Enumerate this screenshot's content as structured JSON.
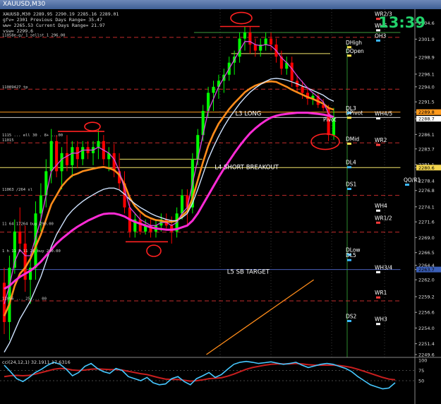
{
  "window": {
    "title": "XAUUSD,M30"
  },
  "header_info": {
    "ohlc": "XAUUSD,M30  2289.95 2290.19 2285.16 2289.01",
    "line2": "gfv= 2301      Previous Days Range= 35.47",
    "line3": "ww= 2265.53    Current Days Range= 21.97",
    "line4": "vsw= 2299.6"
  },
  "clock": "13:39",
  "colors": {
    "background": "#000000",
    "candle_up": "#00ff00",
    "candle_down": "#ff0000",
    "ma_orange": "#ff8c1a",
    "ma_lightblue": "#cfe3ff",
    "ma_magenta": "#ff2bd6",
    "ma_thin_magenta": "#d84be0",
    "level_red": "#c22b2b",
    "level_green": "#3d9b3d",
    "osc_blue": "#46c8ff",
    "osc_red": "#c81e1e",
    "circle": "#ff2020"
  },
  "chart_data": {
    "type": "candlestick",
    "symbol": "XAUUSD",
    "timeframe": "M30",
    "ylim": [
      2249.6,
      2306.4
    ],
    "y_ticks": [
      "2304.6",
      "2301.9",
      "2298.9",
      "2296.1",
      "2294.0",
      "2291.5",
      "2289.8",
      "2288.7",
      "2286.1",
      "2283.7",
      "2281.1",
      "2280.6",
      "2278.4",
      "2276.8",
      "2274.1",
      "2271.6",
      "2269.0",
      "2266.5",
      "2264.4",
      "2263.7",
      "2262.0",
      "2259.2",
      "2256.6",
      "2254.0",
      "2251.4",
      "2249.6"
    ],
    "y_ticks_highlight": [
      "2289.8",
      "2288.7",
      "2280.6",
      "2263.7"
    ],
    "last_price": "2288.7",
    "candles": [
      [
        2261.5,
        2264.0,
        2253.0,
        2255.0
      ],
      [
        2255.0,
        2266.0,
        2252.0,
        2264.0
      ],
      [
        2264.0,
        2272.0,
        2263.0,
        2270.0
      ],
      [
        2270.0,
        2274.0,
        2267.0,
        2268.0
      ],
      [
        2268.0,
        2271.0,
        2260.0,
        2262.0
      ],
      [
        2262.0,
        2266.0,
        2258.0,
        2264.0
      ],
      [
        2264.0,
        2275.0,
        2262.0,
        2273.0
      ],
      [
        2273.0,
        2278.0,
        2270.0,
        2276.0
      ],
      [
        2276.0,
        2282.0,
        2274.0,
        2280.0
      ],
      [
        2280.0,
        2287.0,
        2278.0,
        2285.0
      ],
      [
        2285.0,
        2286.0,
        2279.0,
        2280.0
      ],
      [
        2280.0,
        2284.0,
        2277.0,
        2283.0
      ],
      [
        2283.0,
        2286.0,
        2280.0,
        2281.0
      ],
      [
        2281.0,
        2285.0,
        2279.0,
        2284.0
      ],
      [
        2284.0,
        2285.0,
        2280.5,
        2282.0
      ],
      [
        2282.0,
        2285.0,
        2281.0,
        2284.0
      ],
      [
        2284.0,
        2285.0,
        2282.0,
        2283.0
      ],
      [
        2283.0,
        2285.0,
        2281.0,
        2284.0
      ],
      [
        2284.0,
        2287.0,
        2282.0,
        2285.0
      ],
      [
        2285.0,
        2286.0,
        2281.0,
        2282.0
      ],
      [
        2282.0,
        2284.0,
        2280.0,
        2283.0
      ],
      [
        2283.0,
        2284.5,
        2279.0,
        2280.0
      ],
      [
        2280.0,
        2283.0,
        2277.0,
        2278.0
      ],
      [
        2278.0,
        2280.0,
        2273.0,
        2274.0
      ],
      [
        2274.0,
        2276.0,
        2269.0,
        2270.0
      ],
      [
        2270.0,
        2273.0,
        2269.0,
        2272.0
      ],
      [
        2272.0,
        2273.0,
        2269.5,
        2270.0
      ],
      [
        2270.0,
        2272.0,
        2269.5,
        2271.0
      ],
      [
        2271.0,
        2272.0,
        2269.0,
        2270.0
      ],
      [
        2270.0,
        2272.0,
        2269.0,
        2271.0
      ],
      [
        2271.0,
        2273.0,
        2270.0,
        2272.0
      ],
      [
        2272.0,
        2273.0,
        2270.5,
        2271.0
      ],
      [
        2271.0,
        2272.5,
        2268.0,
        2270.0
      ],
      [
        2270.0,
        2274.0,
        2269.0,
        2273.0
      ],
      [
        2273.0,
        2277.0,
        2272.0,
        2276.0
      ],
      [
        2276.0,
        2277.0,
        2271.0,
        2274.0
      ],
      [
        2274.0,
        2283.0,
        2273.0,
        2282.0
      ],
      [
        2282.0,
        2287.0,
        2281.0,
        2286.0
      ],
      [
        2286.0,
        2291.0,
        2285.0,
        2290.0
      ],
      [
        2290.0,
        2294.0,
        2289.0,
        2293.0
      ],
      [
        2293.0,
        2295.0,
        2290.0,
        2294.0
      ],
      [
        2294.0,
        2296.0,
        2292.0,
        2295.0
      ],
      [
        2295.0,
        2297.0,
        2293.0,
        2296.0
      ],
      [
        2296.0,
        2299.0,
        2295.0,
        2298.0
      ],
      [
        2298.0,
        2300.0,
        2296.0,
        2299.0
      ],
      [
        2299.0,
        2303.0,
        2298.0,
        2302.0
      ],
      [
        2302.0,
        2304.0,
        2300.0,
        2303.0
      ],
      [
        2303.0,
        2304.0,
        2299.5,
        2301.0
      ],
      [
        2301.0,
        2302.0,
        2299.0,
        2300.0
      ],
      [
        2300.0,
        2302.0,
        2299.0,
        2301.0
      ],
      [
        2301.0,
        2303.0,
        2300.0,
        2302.0
      ],
      [
        2302.0,
        2303.0,
        2300.0,
        2301.0
      ],
      [
        2301.0,
        2302.0,
        2298.0,
        2299.0
      ],
      [
        2299.0,
        2300.0,
        2296.0,
        2297.0
      ],
      [
        2297.0,
        2299.0,
        2296.0,
        2298.0
      ],
      [
        2298.0,
        2299.0,
        2294.0,
        2295.0
      ],
      [
        2295.0,
        2296.0,
        2293.0,
        2294.0
      ],
      [
        2294.0,
        2295.0,
        2292.0,
        2293.0
      ],
      [
        2293.0,
        2294.0,
        2291.0,
        2292.0
      ],
      [
        2292.0,
        2293.0,
        2291.0,
        2292.5
      ],
      [
        2292.5,
        2293.0,
        2290.5,
        2291.0
      ],
      [
        2291.0,
        2292.0,
        2290.0,
        2290.5
      ],
      [
        2290.5,
        2291.0,
        2285.0,
        2286.0
      ],
      [
        2286.0,
        2290.5,
        2285.2,
        2289.0
      ]
    ],
    "moving_averages": [
      {
        "id": "orange",
        "values": [
          2256,
          2258,
          2261,
          2263,
          2264,
          2265.5,
          2267.5,
          2269.5,
          2272,
          2274.5,
          2276,
          2277.5,
          2278.5,
          2279.3,
          2279.6,
          2280,
          2280.2,
          2280.4,
          2280.6,
          2280.7,
          2280.5,
          2280.2,
          2279.4,
          2277.8,
          2275.6,
          2274.2,
          2273.3,
          2272.6,
          2272.2,
          2271.9,
          2271.8,
          2271.6,
          2271.6,
          2271.8,
          2272.6,
          2273.4,
          2275.5,
          2278.5,
          2281.5,
          2284.2,
          2286.2,
          2287.9,
          2289.1,
          2290.3,
          2291.3,
          2292.2,
          2293.1,
          2293.7,
          2294.2,
          2294.5,
          2294.8,
          2294.9,
          2294.8,
          2294.4,
          2294,
          2293.5,
          2293.1,
          2292.7,
          2292.3,
          2292,
          2291.6,
          2291.2,
          2290.5,
          2290.2
        ]
      },
      {
        "id": "lightblue",
        "values": [
          2250,
          2251.5,
          2253.5,
          2255.5,
          2257,
          2258.5,
          2260.5,
          2262.5,
          2265,
          2267.5,
          2269.5,
          2271,
          2272.5,
          2273.5,
          2274.3,
          2275,
          2275.6,
          2276.1,
          2276.6,
          2277,
          2277.2,
          2277.2,
          2276.9,
          2276.2,
          2275.3,
          2274.6,
          2274,
          2273.5,
          2273,
          2272.6,
          2272.3,
          2272,
          2271.8,
          2271.8,
          2272.3,
          2273,
          2274.7,
          2277,
          2279.5,
          2282,
          2284,
          2285.8,
          2287.4,
          2288.8,
          2290,
          2291.2,
          2292.2,
          2293.1,
          2293.8,
          2294.4,
          2294.9,
          2295.3,
          2295.4,
          2295.3,
          2295.1,
          2294.8,
          2294.5,
          2294.1,
          2293.8,
          2293.4,
          2293,
          2292.6,
          2292,
          2291.6
        ]
      },
      {
        "id": "magenta_thick",
        "values": [
          2260.5,
          2261,
          2261.8,
          2262.5,
          2263,
          2263.5,
          2264.2,
          2265,
          2266,
          2267,
          2268,
          2268.8,
          2269.5,
          2270.2,
          2270.8,
          2271.3,
          2271.8,
          2272.2,
          2272.6,
          2272.9,
          2273,
          2273,
          2272.8,
          2272.5,
          2272,
          2271.6,
          2271.3,
          2271,
          2270.7,
          2270.5,
          2270.4,
          2270.3,
          2270.3,
          2270.4,
          2270.7,
          2271,
          2271.8,
          2273,
          2274.5,
          2276,
          2277.5,
          2279,
          2280.4,
          2281.7,
          2283,
          2284.2,
          2285.3,
          2286.3,
          2287.1,
          2287.8,
          2288.4,
          2288.9,
          2289.2,
          2289.4,
          2289.5,
          2289.6,
          2289.7,
          2289.7,
          2289.7,
          2289.6,
          2289.5,
          2289.4,
          2289.2,
          2289
        ]
      },
      {
        "id": "magenta_thin",
        "values": [
          2258,
          2261,
          2265,
          2267,
          2266,
          2266,
          2269,
          2272,
          2276,
          2280,
          2281,
          2282,
          2282.5,
          2283,
          2283,
          2283.5,
          2283.5,
          2283.5,
          2284,
          2283.5,
          2283,
          2282,
          2280,
          2277,
          2274,
          2273,
          2272,
          2271.5,
          2271,
          2271,
          2271.5,
          2271.5,
          2271,
          2271.5,
          2273,
          2274,
          2278,
          2282,
          2286,
          2290,
          2292,
          2294,
          2295.5,
          2297,
          2298.5,
          2300,
          2301.5,
          2301.5,
          2301,
          2300.8,
          2301,
          2300.8,
          2300,
          2298.8,
          2298,
          2297,
          2295.8,
          2294.8,
          2293.8,
          2293,
          2292.3,
          2291.5,
          2289.5,
          2289
        ]
      }
    ],
    "levels": [
      {
        "label": "",
        "price": 2303.0,
        "style": "solid_green",
        "x0": 0.47,
        "x1": 0.97
      },
      {
        "label": "",
        "price": 2302.2,
        "style": "dashed_red",
        "x0": 0.0,
        "x1": 0.97
      },
      {
        "label": "",
        "price": 2299.5,
        "style": "solid_yellow",
        "x0": 0.56,
        "x1": 0.8
      },
      {
        "label": "",
        "price": 2293.6,
        "style": "dashed_red",
        "x0": 0.0,
        "x1": 0.97
      },
      {
        "label": "",
        "price": 2289.8,
        "style": "solid_orange",
        "x0": 0.0,
        "x1": 0.97
      },
      {
        "label": "",
        "price": 2288.9,
        "style": "solid_white",
        "x0": 0.0,
        "x1": 0.97
      },
      {
        "label": "",
        "price": 2284.7,
        "style": "dashed_red",
        "x0": 0.0,
        "x1": 0.97
      },
      {
        "label": "",
        "price": 2282.0,
        "style": "solid_yellow",
        "x0": 0.29,
        "x1": 0.49
      },
      {
        "label": "",
        "price": 2280.6,
        "style": "solid_yellow",
        "x0": 0.0,
        "x1": 0.97
      },
      {
        "label": "",
        "price": 2276.0,
        "style": "dashed_red",
        "x0": 0.0,
        "x1": 0.97
      },
      {
        "label": "",
        "price": 2269.9,
        "style": "dashed_red",
        "x0": 0.0,
        "x1": 0.97
      },
      {
        "label": "",
        "price": 2263.7,
        "style": "solid_blue",
        "x0": 0.0,
        "x1": 0.97
      },
      {
        "label": "",
        "price": 2258.5,
        "style": "dashed_red",
        "x0": 0.0,
        "x1": 0.97
      }
    ],
    "level_labels": [
      {
        "text": "WR2/3",
        "price": 2305.5,
        "side": "right",
        "color": "#ffffff"
      },
      {
        "text": "WH5",
        "price": 2303.6,
        "side": "right",
        "color": "#ffffff"
      },
      {
        "text": "OH3",
        "price": 2301.9,
        "side": "right",
        "color": "#ffffff"
      },
      {
        "text": "DHigh",
        "price": 2300.8,
        "side": "mid",
        "color": "#ffffff"
      },
      {
        "text": "DOpen",
        "price": 2299.4,
        "side": "mid",
        "color": "#ffffff"
      },
      {
        "text": "DL3",
        "price": 2289.9,
        "side": "mid",
        "color": "#ffffff"
      },
      {
        "text": "DPivot",
        "price": 2289.1,
        "side": "mid",
        "color": "#ffffff"
      },
      {
        "text": "WH4/5",
        "price": 2289.0,
        "side": "right",
        "color": "#ffffff"
      },
      {
        "text": "Pivot",
        "price": 2288.0,
        "side": "mid2",
        "color": "#ffffff"
      },
      {
        "text": "DMid",
        "price": 2284.8,
        "side": "mid",
        "color": "#ffffff"
      },
      {
        "text": "WR2",
        "price": 2284.6,
        "side": "right",
        "color": "#ffffff"
      },
      {
        "text": "DL4",
        "price": 2280.9,
        "side": "mid",
        "color": "#ffffff"
      },
      {
        "text": "DS1",
        "price": 2277.3,
        "side": "mid",
        "color": "#ffffff"
      },
      {
        "text": "QO/R1",
        "price": 2278.0,
        "side": "right2",
        "color": "#ffffff"
      },
      {
        "text": "WH4",
        "price": 2273.7,
        "side": "right",
        "color": "#ffffff"
      },
      {
        "text": "WR1/2",
        "price": 2271.7,
        "side": "right",
        "color": "#ffffff"
      },
      {
        "text": "DLow",
        "price": 2266.4,
        "side": "mid",
        "color": "#ffffff"
      },
      {
        "text": "DL5",
        "price": 2265.5,
        "side": "mid",
        "color": "#ffffff"
      },
      {
        "text": "WH3/4",
        "price": 2263.5,
        "side": "right",
        "color": "#ffffff"
      },
      {
        "text": "WR1",
        "price": 2259.3,
        "side": "right",
        "color": "#ffffff"
      },
      {
        "text": "DS2",
        "price": 2255.4,
        "side": "mid",
        "color": "#ffffff"
      },
      {
        "text": "WH3",
        "price": 2254.9,
        "side": "right",
        "color": "#ffffff"
      }
    ],
    "text_labels": [
      {
        "text": "L3 LONG",
        "price": 2289.0,
        "x": 0.57
      },
      {
        "text": "L4 SHORT BREAKOUT",
        "price": 2280.1,
        "x": 0.52
      },
      {
        "text": "L5 SB TARGET",
        "price": 2262.8,
        "x": 0.55
      }
    ],
    "left_labels": [
      {
        "text": "11058e-g/ 1 sellst 1 296.00",
        "price": 2302.2
      },
      {
        "text": "11089427 tp",
        "price": 2293.6
      },
      {
        "text": "1115 ... ell 30 . 8+ ...00",
        "price": 2285.6
      },
      {
        "text": "11015",
        "price": 2284.8
      },
      {
        "text": "11063 /264 sl",
        "price": 2276.6
      },
      {
        "text": "11 64 17264 buy 290.00",
        "price": 2270.9
      },
      {
        "text": "1 h 11 5 11 26 buy 290.00",
        "price": 2266.4
      },
      {
        "text": "11056 ... 25 ... 00",
        "price": 2258.5
      }
    ],
    "trendline": {
      "from": [
        0.5,
        2249.6
      ],
      "to": [
        0.76,
        2262.0
      ],
      "color": "#ff8c1a"
    },
    "oscillator": {
      "title": "cci(24,12,1) 32.1911 17.6316",
      "ylim": [
        0,
        100
      ],
      "y_ticks": [
        "100",
        "75",
        "50"
      ],
      "blue": [
        88,
        72,
        55,
        48,
        58,
        70,
        78,
        88,
        95,
        90,
        78,
        62,
        70,
        85,
        92,
        80,
        72,
        68,
        80,
        75,
        60,
        55,
        50,
        58,
        45,
        40,
        42,
        55,
        60,
        48,
        40,
        55,
        62,
        70,
        58,
        65,
        78,
        90,
        95,
        97,
        95,
        92,
        94,
        96,
        93,
        90,
        92,
        95,
        88,
        82,
        86,
        90,
        92,
        90,
        85,
        80,
        72,
        60,
        50,
        40,
        35,
        30,
        32,
        45
      ],
      "red": [
        60,
        62,
        63,
        62,
        63,
        66,
        70,
        74,
        78,
        80,
        79,
        76,
        75,
        76,
        78,
        79,
        78,
        77,
        77,
        76,
        73,
        70,
        67,
        65,
        61,
        57,
        54,
        53,
        53,
        51,
        49,
        50,
        52,
        55,
        56,
        57,
        61,
        66,
        72,
        78,
        82,
        85,
        88,
        90,
        91,
        91,
        91,
        92,
        91,
        89,
        88,
        88,
        88,
        88,
        87,
        85,
        82,
        78,
        73,
        68,
        63,
        58,
        54,
        52
      ]
    }
  }
}
